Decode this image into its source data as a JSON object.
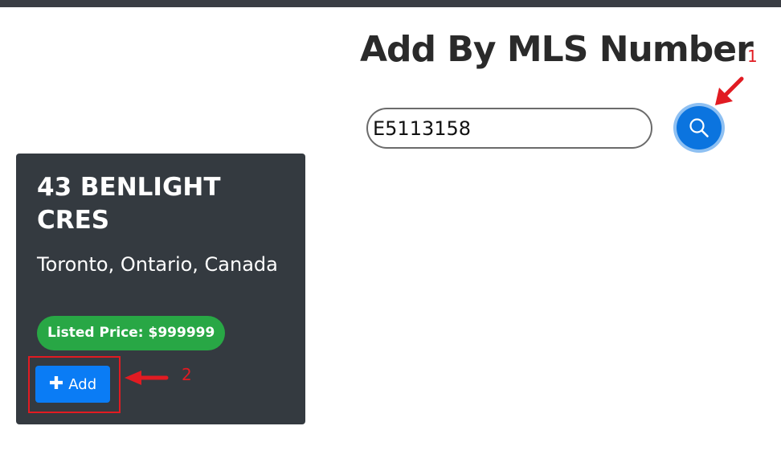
{
  "header": {
    "title": "Add By MLS Number"
  },
  "search": {
    "value": "E5113158",
    "button_icon": "search-icon"
  },
  "listing": {
    "street": "43 BENLIGHT CRES",
    "location": "Toronto, Ontario, Canada",
    "price_label": "Listed Price: $999999",
    "add_label": "Add"
  },
  "annotations": {
    "step1": "1",
    "step2": "2",
    "color": "#e11b22"
  },
  "colors": {
    "card_bg": "#343a40",
    "accent": "#0a7cf5",
    "badge": "#28a745"
  }
}
